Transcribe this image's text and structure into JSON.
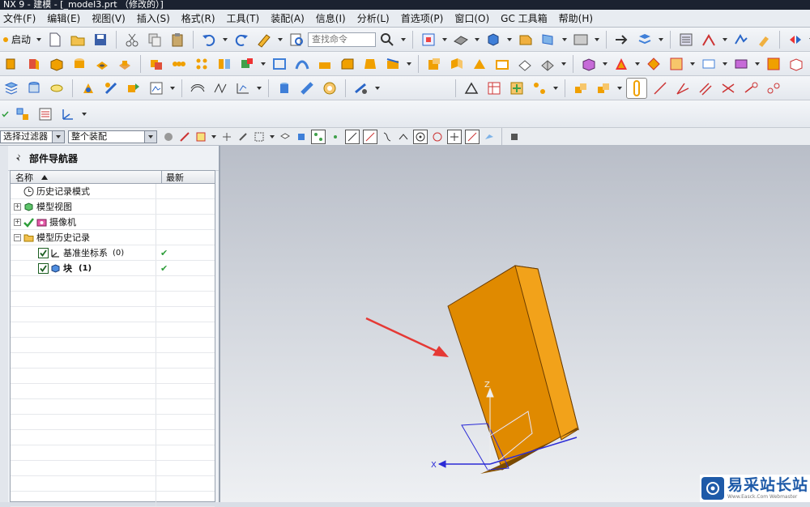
{
  "window": {
    "title": "NX 9 - 建模 - [_model3.prt （修改的）]"
  },
  "menu": {
    "items": [
      "文件(F)",
      "编辑(E)",
      "视图(V)",
      "插入(S)",
      "格式(R)",
      "工具(T)",
      "装配(A)",
      "信息(I)",
      "分析(L)",
      "首选项(P)",
      "窗口(O)",
      "GC 工具箱",
      "帮助(H)"
    ]
  },
  "toolbar": {
    "start_label": "启动",
    "search_placeholder": "查找命令"
  },
  "selection_bar": {
    "filter_value": "选择过滤器",
    "scope_value": "整个装配"
  },
  "navigator": {
    "title": "部件导航器",
    "columns": {
      "name": "名称",
      "latest": "最新"
    },
    "rows": [
      {
        "label": "历史记录模式",
        "latest": ""
      },
      {
        "label": "模型视图",
        "latest": ""
      },
      {
        "label": "摄像机",
        "latest": ""
      },
      {
        "label": "模型历史记录",
        "latest": ""
      },
      {
        "label": "基准坐标系",
        "suffix": "(0)",
        "latest": "✔"
      },
      {
        "label": "块",
        "suffix": "(1)",
        "latest": "✔"
      }
    ]
  },
  "viewport": {
    "axis_z": "Z",
    "axis_x": "X",
    "block_color": "#e08a00",
    "arrow_color": "#e53935"
  },
  "watermark": {
    "main": "易采站长站",
    "sub": "Www.Easck.Com Webmaster"
  }
}
